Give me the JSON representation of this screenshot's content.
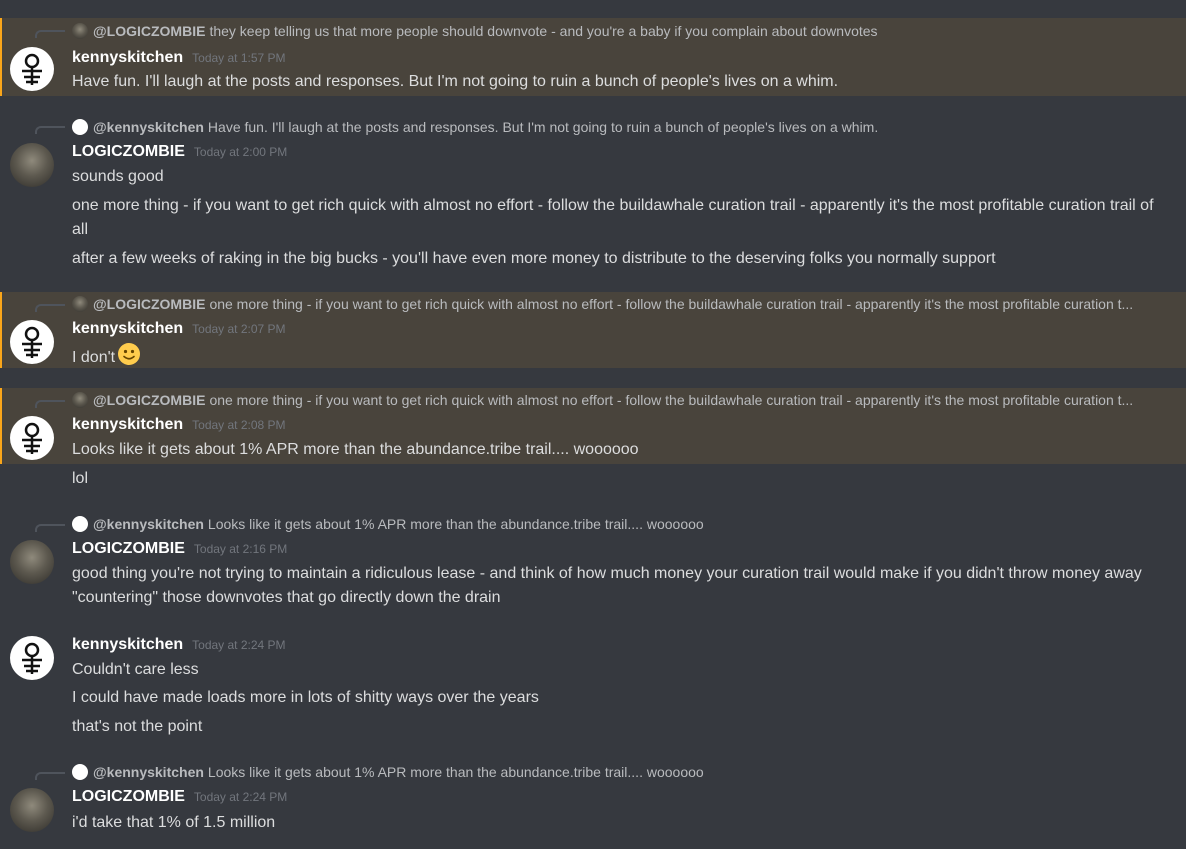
{
  "messages": [
    {
      "id": "m1",
      "mention": true,
      "reply": {
        "name": "@LOGICZOMBIE",
        "avatar": "logiczombie",
        "text": "they keep telling us that more people should downvote - and you're a baby if you complain about downvotes"
      },
      "author": "kennyskitchen",
      "avatar": "kennyskitchen",
      "time": "Today at 1:57 PM",
      "lines": [
        "Have fun. I'll laugh at the posts and responses. But I'm not going to ruin a bunch of people's lives on a whim."
      ]
    },
    {
      "id": "m2",
      "mention": false,
      "reply": {
        "name": "@kennyskitchen",
        "avatar": "kennyskitchen",
        "text": "Have fun. I'll laugh at the posts and responses. But I'm not going to ruin a bunch of people's lives on a whim."
      },
      "author": "LOGICZOMBIE",
      "avatar": "logiczombie",
      "time": "Today at 2:00 PM",
      "lines": [
        "sounds good",
        "one more thing - if you want to get rich quick with almost no effort - follow the buildawhale curation trail - apparently it's the most profitable curation trail of all",
        "after a few weeks of raking in the big bucks - you'll have even more money to distribute to the deserving folks you normally support"
      ]
    },
    {
      "id": "m3",
      "mention": true,
      "reply": {
        "name": "@LOGICZOMBIE",
        "avatar": "logiczombie",
        "text": "one more thing - if you want to get rich quick with almost no effort - follow the buildawhale curation trail - apparently it's the most profitable curation t..."
      },
      "author": "kennyskitchen",
      "avatar": "kennyskitchen",
      "time": "Today at 2:07 PM",
      "lines": [
        "I don't"
      ],
      "emoji": "slightly-smiling-face"
    },
    {
      "id": "m4",
      "mention": true,
      "reply": {
        "name": "@LOGICZOMBIE",
        "avatar": "logiczombie",
        "text": "one more thing - if you want to get rich quick with almost no effort - follow the buildawhale curation trail - apparently it's the most profitable curation t..."
      },
      "author": "kennyskitchen",
      "avatar": "kennyskitchen",
      "time": "Today at 2:08 PM",
      "lines": [
        "Looks like it gets about 1% APR more than the abundance.tribe trail.... woooooo",
        "lol"
      ]
    },
    {
      "id": "m5",
      "mention": false,
      "reply": {
        "name": "@kennyskitchen",
        "avatar": "kennyskitchen",
        "text": "Looks like it gets about 1% APR more than the abundance.tribe trail.... woooooo"
      },
      "author": "LOGICZOMBIE",
      "avatar": "logiczombie",
      "time": "Today at 2:16 PM",
      "lines": [
        "good thing you're not trying to maintain a ridiculous lease - and think of how much money your curation trail would make if you didn't throw money away \"countering\" those downvotes that go directly down the drain"
      ]
    },
    {
      "id": "m6",
      "mention": false,
      "reply": null,
      "author": "kennyskitchen",
      "avatar": "kennyskitchen",
      "time": "Today at 2:24 PM",
      "lines": [
        "Couldn't care less",
        "I could have made loads more in lots of shitty ways over the years",
        "that's not the point"
      ]
    },
    {
      "id": "m7",
      "mention": false,
      "reply": {
        "name": "@kennyskitchen",
        "avatar": "kennyskitchen",
        "text": "Looks like it gets about 1% APR more than the abundance.tribe trail.... woooooo"
      },
      "author": "LOGICZOMBIE",
      "avatar": "logiczombie",
      "time": "Today at 2:24 PM",
      "lines": [
        "i'd take that 1% of 1.5 million"
      ]
    }
  ]
}
